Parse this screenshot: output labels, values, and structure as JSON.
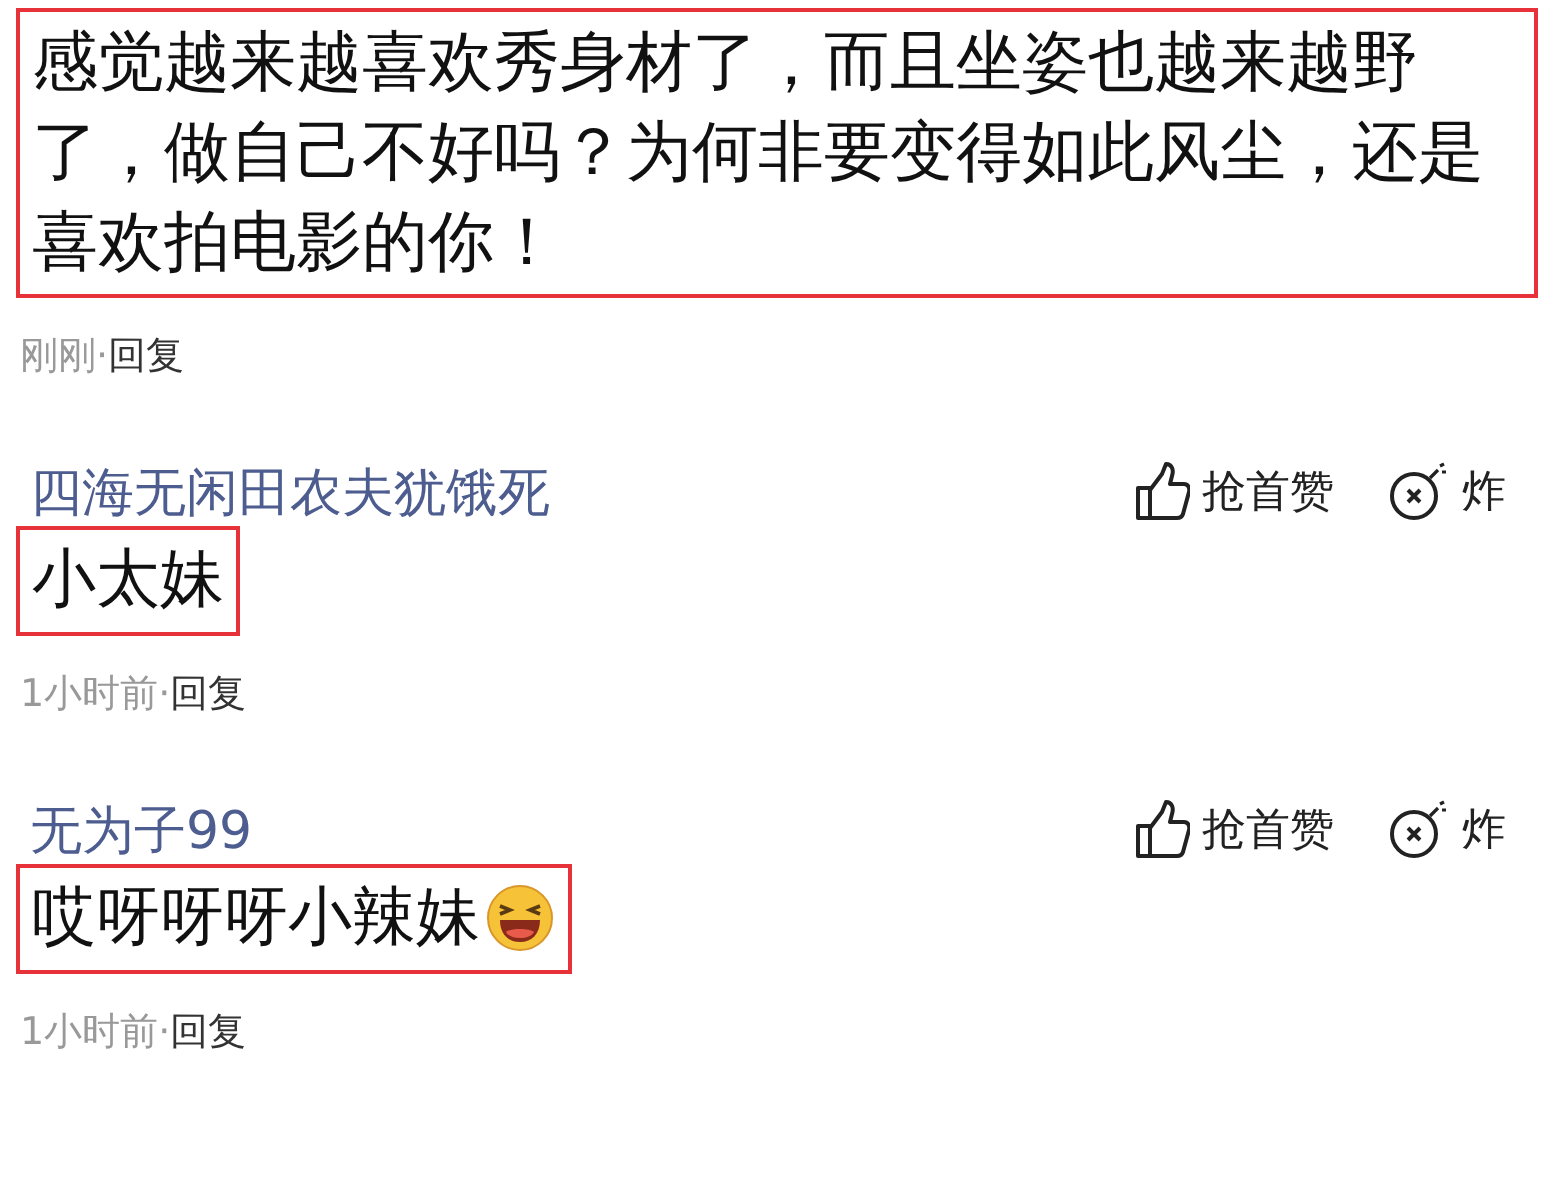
{
  "comments": [
    {
      "text": "感觉越来越喜欢秀身材了，而且坐姿也越来越野了，做自己不好吗？为何非要变得如此风尘，还是喜欢拍电影的你！",
      "highlighted": true,
      "time": "刚刚",
      "separator": "·",
      "reply": "回复"
    },
    {
      "user": "四海无闲田农夫犹饿死",
      "like": "抢首赞",
      "bomb": "炸",
      "text": "小太妹",
      "highlighted": true,
      "time": "1小时前",
      "separator": "·",
      "reply": "回复"
    },
    {
      "user": "无为子99",
      "like": "抢首赞",
      "bomb": "炸",
      "text": "哎呀呀呀小辣妹",
      "has_emoji": true,
      "highlighted": true,
      "time": "1小时前",
      "separator": "·",
      "reply": "回复"
    }
  ]
}
